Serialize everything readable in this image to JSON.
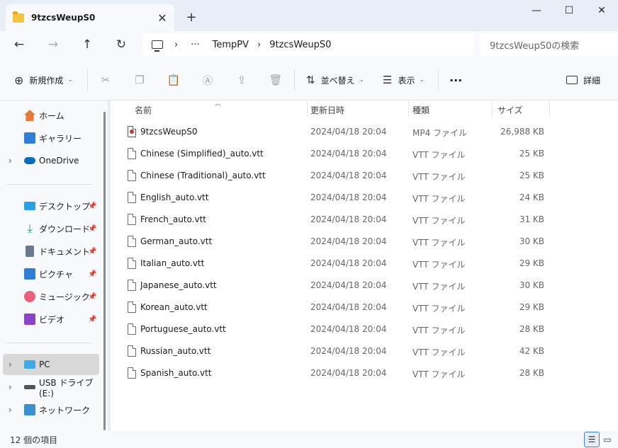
{
  "tab": {
    "title": "9tzcsWeupS0",
    "close": "✕",
    "new": "+"
  },
  "window": {
    "minimize": "—",
    "maximize": "☐",
    "close": "✕"
  },
  "nav": {
    "back": "←",
    "forward": "→",
    "up": "↑",
    "refresh": "↻"
  },
  "address": {
    "more": "···",
    "crumbs": [
      "TempPV",
      "9tzcsWeupS0"
    ],
    "separator": "›"
  },
  "search": {
    "placeholder": "9tzcsWeupS0の検索"
  },
  "toolbar": {
    "new_label": "新規作成",
    "sort_label": "並べ替え",
    "view_label": "表示",
    "more_label": "···",
    "details_label": "詳細"
  },
  "sidebar": {
    "items": [
      {
        "label": "ホーム",
        "icon": "home-icon"
      },
      {
        "label": "ギャラリー",
        "icon": "gallery-icon"
      },
      {
        "label": "OneDrive",
        "icon": "onedrive-icon"
      },
      {
        "label": "デスクトップ",
        "icon": "desktop-icon"
      },
      {
        "label": "ダウンロード",
        "icon": "download-icon"
      },
      {
        "label": "ドキュメント",
        "icon": "document-icon"
      },
      {
        "label": "ピクチャ",
        "icon": "pictures-icon"
      },
      {
        "label": "ミュージック",
        "icon": "music-icon"
      },
      {
        "label": "ビデオ",
        "icon": "video-icon"
      },
      {
        "label": "PC",
        "icon": "pc-icon"
      },
      {
        "label": "USB ドライブ (E:)",
        "icon": "usb-drive-icon"
      },
      {
        "label": "ネットワーク",
        "icon": "network-icon"
      }
    ]
  },
  "columns": {
    "name": "名前",
    "date": "更新日時",
    "type": "種類",
    "size": "サイズ"
  },
  "files": [
    {
      "name": "9tzcsWeupS0",
      "date": "2024/04/18 20:04",
      "type": "MP4 ファイル",
      "size": "26,988 KB",
      "kind": "video"
    },
    {
      "name": "Chinese (Simplified)_auto.vtt",
      "date": "2024/04/18 20:04",
      "type": "VTT ファイル",
      "size": "25 KB",
      "kind": "text"
    },
    {
      "name": "Chinese (Traditional)_auto.vtt",
      "date": "2024/04/18 20:04",
      "type": "VTT ファイル",
      "size": "25 KB",
      "kind": "text"
    },
    {
      "name": "English_auto.vtt",
      "date": "2024/04/18 20:04",
      "type": "VTT ファイル",
      "size": "24 KB",
      "kind": "text"
    },
    {
      "name": "French_auto.vtt",
      "date": "2024/04/18 20:04",
      "type": "VTT ファイル",
      "size": "31 KB",
      "kind": "text"
    },
    {
      "name": "German_auto.vtt",
      "date": "2024/04/18 20:04",
      "type": "VTT ファイル",
      "size": "30 KB",
      "kind": "text"
    },
    {
      "name": "Italian_auto.vtt",
      "date": "2024/04/18 20:04",
      "type": "VTT ファイル",
      "size": "29 KB",
      "kind": "text"
    },
    {
      "name": "Japanese_auto.vtt",
      "date": "2024/04/18 20:04",
      "type": "VTT ファイル",
      "size": "30 KB",
      "kind": "text"
    },
    {
      "name": "Korean_auto.vtt",
      "date": "2024/04/18 20:04",
      "type": "VTT ファイル",
      "size": "29 KB",
      "kind": "text"
    },
    {
      "name": "Portuguese_auto.vtt",
      "date": "2024/04/18 20:04",
      "type": "VTT ファイル",
      "size": "28 KB",
      "kind": "text"
    },
    {
      "name": "Russian_auto.vtt",
      "date": "2024/04/18 20:04",
      "type": "VTT ファイル",
      "size": "42 KB",
      "kind": "text"
    },
    {
      "name": "Spanish_auto.vtt",
      "date": "2024/04/18 20:04",
      "type": "VTT ファイル",
      "size": "28 KB",
      "kind": "text"
    }
  ],
  "status": {
    "count": "12 個の項目"
  }
}
